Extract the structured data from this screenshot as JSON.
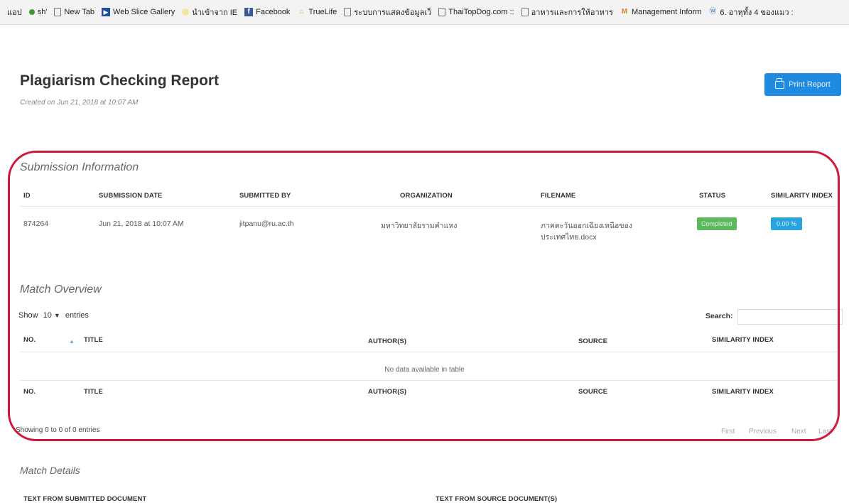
{
  "bookmarks": [
    {
      "label": "แอป",
      "icon": "apps-icon"
    },
    {
      "label": "sh'",
      "icon": "green-dot-icon"
    },
    {
      "label": "New Tab",
      "icon": "page-icon"
    },
    {
      "label": "Web Slice Gallery",
      "icon": "web-slice-icon"
    },
    {
      "label": "นำเข้าจาก IE",
      "icon": "folder-icon"
    },
    {
      "label": "Facebook",
      "icon": "facebook-icon"
    },
    {
      "label": "TrueLife",
      "icon": "house-icon"
    },
    {
      "label": "ระบบการแสดงข้อมูลเว็",
      "icon": "page-icon"
    },
    {
      "label": "ThaiTopDog.com :: ",
      "icon": "page-icon"
    },
    {
      "label": "อาหารและการให้อาหาร",
      "icon": "page-icon"
    },
    {
      "label": "Management Inform",
      "icon": "mi-icon"
    },
    {
      "label": "6. อาหุทั้ง 4 ของแมว :",
      "icon": "wordpress-icon"
    }
  ],
  "header": {
    "title": "Plagiarism Checking Report",
    "created": "Created on Jun 21, 2018 at 10:07 AM",
    "print_label": "Print Report"
  },
  "submission": {
    "section_title": "Submission Information",
    "columns": [
      "ID",
      "SUBMISSION DATE",
      "SUBMITTED BY",
      "ORGANIZATION",
      "FILENAME",
      "STATUS",
      "SIMILARITY INDEX"
    ],
    "row": {
      "id": "874264",
      "date": "Jun 21, 2018 at 10:07 AM",
      "by": "jitpanu@ru.ac.th",
      "org": "มหาวิทยาลัยรามคำแหง",
      "filename_line1": "ภาคตะวันออกเฉียงเหนือของ",
      "filename_line2": "ประเทศไทย.docx",
      "status": "Completed",
      "similarity": "0.00 %"
    }
  },
  "match_overview": {
    "section_title": "Match Overview",
    "show_label": "Show",
    "entries_value": "10",
    "entries_label": "entries",
    "search_label": "Search:",
    "columns": [
      "NO.",
      "TITLE",
      "AUTHOR(S)",
      "SOURCE",
      "SIMILARITY INDEX"
    ],
    "empty_text": "No data available in table",
    "info": "Showing 0 to 0 of 0 entries",
    "pager": [
      "First",
      "Previous",
      "Next",
      "Last"
    ]
  },
  "match_details": {
    "section_title": "Match Details",
    "col_left": "TEXT FROM SUBMITTED DOCUMENT",
    "col_right": "TEXT FROM SOURCE DOCUMENT(S)"
  },
  "colors": {
    "print_button": "#1f8be0",
    "status_badge": "#5cb85c",
    "similarity_badge": "#2aa3dc",
    "highlight": "#d0193a"
  }
}
